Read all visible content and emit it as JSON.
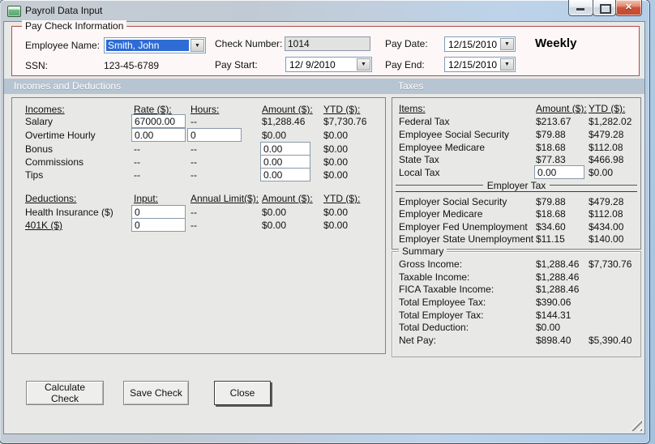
{
  "window": {
    "title": "Payroll Data Input"
  },
  "colors": {
    "selection_blue": "#2e6bd4",
    "paycheck_border_red": "#b14c4c",
    "section_band": "#b7c4d2",
    "close_button_red": "#c14a30",
    "client_background": "#e8e8e6"
  },
  "paycheck": {
    "group_title": "Pay Check Information",
    "employee_name": {
      "label": "Employee Name:",
      "value": "Smith, John"
    },
    "ssn": {
      "label": "SSN:",
      "value": "123-45-6789"
    },
    "check_number": {
      "label": "Check Number:",
      "value": "1014"
    },
    "pay_start": {
      "label": "Pay Start:",
      "value": "12/ 9/2010"
    },
    "pay_date": {
      "label": "Pay Date:",
      "value": "12/15/2010"
    },
    "pay_end": {
      "label": "Pay End:",
      "value": "12/15/2010"
    },
    "frequency": "Weekly"
  },
  "sections": {
    "incomes_band": "Incomes and Deductions",
    "taxes_band": "Taxes"
  },
  "incomes": {
    "headers": {
      "item": "Incomes:",
      "rate": "Rate ($):",
      "hours": "Hours:",
      "amount": "Amount ($):",
      "ytd": "YTD ($):"
    },
    "rows": [
      {
        "label": "Salary",
        "rate": "67000.00",
        "hours": "--",
        "amount": "$1,288.46",
        "ytd": "$7,730.76"
      },
      {
        "label": "Overtime Hourly",
        "rate": "0.00",
        "hours": "0",
        "amount": "$0.00",
        "ytd": "$0.00"
      },
      {
        "label": "Bonus",
        "rate": "--",
        "hours": "--",
        "amount": "0.00",
        "ytd": "$0.00"
      },
      {
        "label": "Commissions",
        "rate": "--",
        "hours": "--",
        "amount": "0.00",
        "ytd": "$0.00"
      },
      {
        "label": "Tips",
        "rate": "--",
        "hours": "--",
        "amount": "0.00",
        "ytd": "$0.00"
      }
    ]
  },
  "deductions": {
    "headers": {
      "item": "Deductions:",
      "input": "Input:",
      "annual_limit": "Annual Limit($):",
      "amount": "Amount ($):",
      "ytd": "YTD ($):"
    },
    "rows": [
      {
        "label": "Health Insurance  ($)",
        "input": "0",
        "annual_limit": "--",
        "amount": "$0.00",
        "ytd": "$0.00"
      },
      {
        "label": "401K  ($)",
        "input": "0",
        "annual_limit": "--",
        "amount": "$0.00",
        "ytd": "$0.00"
      }
    ]
  },
  "taxes": {
    "headers": {
      "item": "Items:",
      "amount": "Amount ($):",
      "ytd": "YTD ($):"
    },
    "rows": [
      {
        "label": "Federal Tax",
        "amount": "$213.67",
        "ytd": "$1,282.02"
      },
      {
        "label": "Employee Social Security",
        "amount": "$79.88",
        "ytd": "$479.28"
      },
      {
        "label": "Employee Medicare",
        "amount": "$18.68",
        "ytd": "$112.08"
      },
      {
        "label": "State Tax",
        "amount": "$77.83",
        "ytd": "$466.98"
      },
      {
        "label": "Local Tax",
        "amount": "0.00",
        "ytd": "$0.00"
      }
    ],
    "employer_title": "Employer Tax",
    "employer_rows": [
      {
        "label": "Employer Social Security",
        "amount": "$79.88",
        "ytd": "$479.28"
      },
      {
        "label": "Employer Medicare",
        "amount": "$18.68",
        "ytd": "$112.08"
      },
      {
        "label": "Employer Fed Unemployment",
        "amount": "$34.60",
        "ytd": "$434.00"
      },
      {
        "label": "Employer State Unemployment",
        "amount": "$11.15",
        "ytd": "$140.00"
      }
    ]
  },
  "summary": {
    "group_title": "Summary",
    "rows": [
      {
        "label": "Gross Income:",
        "amount": "$1,288.46",
        "ytd": "$7,730.76"
      },
      {
        "label": "Taxable Income:",
        "amount": "$1,288.46",
        "ytd": ""
      },
      {
        "label": "FICA Taxable Income:",
        "amount": "$1,288.46",
        "ytd": ""
      },
      {
        "label": "Total Employee Tax:",
        "amount": "$390.06",
        "ytd": ""
      },
      {
        "label": "Total Employer Tax:",
        "amount": "$144.31",
        "ytd": ""
      },
      {
        "label": "Total Deduction:",
        "amount": "$0.00",
        "ytd": ""
      },
      {
        "label": "Net Pay:",
        "amount": "$898.40",
        "ytd": "$5,390.40"
      }
    ]
  },
  "buttons": {
    "calculate": "Calculate Check",
    "save": "Save Check",
    "close": "Close"
  }
}
